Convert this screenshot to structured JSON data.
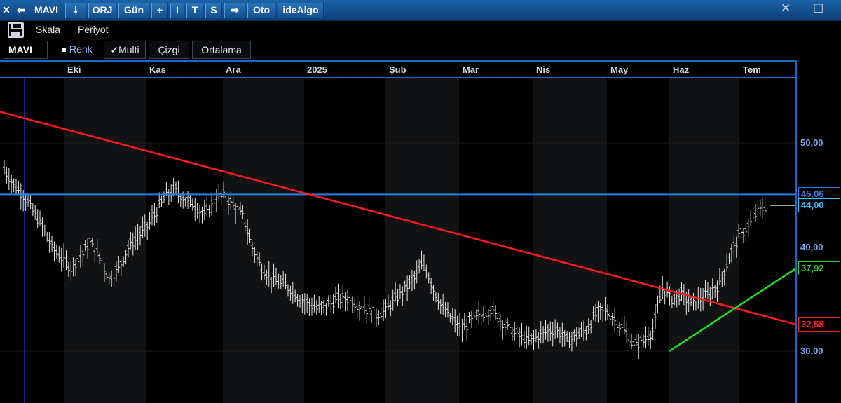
{
  "titlebar": {
    "close_glyph": "✕",
    "back_glyph": "⬅",
    "symbol": "MAVI",
    "down_glyph": "🠗",
    "orj": "ORJ",
    "period": "Gün",
    "plus": "+",
    "i_btn": "I",
    "t_btn": "T",
    "s_btn": "S",
    "arrow_glyph": "➡",
    "oto": "Oto",
    "idealgo": "ideAlgo",
    "maximize_glyph": "☐",
    "close_win_glyph": "✕"
  },
  "toolbar1": {
    "skala": "Skala",
    "periyot": "Periyot"
  },
  "toolbar2": {
    "symbol_tab": "MAVI",
    "renk": "Renk",
    "multi": "Multi",
    "cizgi": "Çizgi",
    "ortalama": "Ortalama"
  },
  "months": [
    "Eki",
    "Kas",
    "Ara",
    "2025",
    "Şub",
    "Mar",
    "Nis",
    "May",
    "Haz",
    "Tem"
  ],
  "axis": {
    "ticks": [
      "50,00",
      "40,00",
      "30,00"
    ],
    "tick_values": [
      50,
      40,
      30
    ],
    "labels": [
      {
        "text": "45,06",
        "value": 45.06,
        "color": "#2a7de1"
      },
      {
        "text": "44,00",
        "value": 44.0,
        "color": "#36c6ff"
      },
      {
        "text": "37,92",
        "value": 37.92,
        "color": "#33cc33"
      },
      {
        "text": "32,58",
        "value": 32.58,
        "color": "#ff2020"
      }
    ]
  },
  "chart_data": {
    "type": "line",
    "title": "",
    "xlabel": "",
    "ylabel": "",
    "ylim": [
      28,
      55
    ],
    "x_categories": [
      "Eki",
      "Kas",
      "Ara",
      "2025",
      "Şub",
      "Mar",
      "Nis",
      "May",
      "Haz",
      "Tem"
    ],
    "series": [
      {
        "name": "MAVI",
        "values": [
          47.5,
          46,
          45,
          43.5,
          42,
          40,
          39,
          38,
          39,
          40.5,
          39,
          37,
          38,
          40,
          41,
          42,
          43.5,
          45,
          45.5,
          44.5,
          44,
          43,
          44.5,
          45,
          44,
          43,
          40,
          38,
          37,
          36.5,
          36,
          35,
          34.5,
          34,
          34.5,
          35,
          35,
          34.5,
          34,
          33.5,
          34,
          35,
          36,
          37,
          38.5,
          36,
          34,
          33,
          32,
          33,
          33.5,
          34,
          33,
          32,
          31.5,
          31,
          31.5,
          32,
          32,
          31,
          31.5,
          32,
          33.5,
          34,
          33,
          32,
          30.5,
          31,
          32,
          36,
          35,
          35.5,
          34.5,
          35,
          35.5,
          36.5,
          39,
          41,
          42,
          43.5,
          44
        ]
      }
    ],
    "reference_lines": [
      {
        "value": 45.06,
        "color": "#2a7de1"
      },
      {
        "value": 44.0,
        "color": "#ffffff"
      }
    ],
    "trend_lines": [
      {
        "color": "#ff1a1a",
        "from": 53.0,
        "to": 32.58
      },
      {
        "color": "#22dd22",
        "from": 30.0,
        "to": 37.92
      }
    ]
  }
}
